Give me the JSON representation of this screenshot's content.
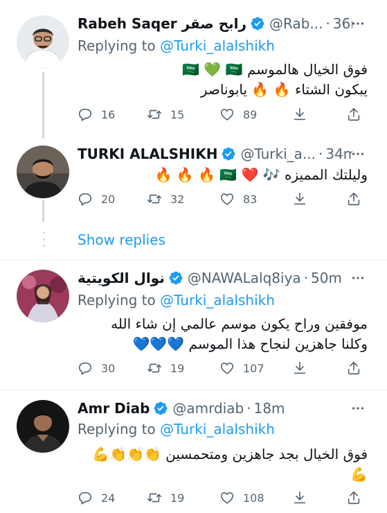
{
  "tweets": [
    {
      "name": "Rabeh Saqer رابح صقر",
      "handle": "@Rab...",
      "time": "36m",
      "reply_prefix": "Replying to",
      "reply_handle": "@Turki_alalshikh",
      "lines": [
        "فوق الخيال هالموسم 🇸🇦 💚 🇸🇦",
        "يبكون الشتاء 🔥 🔥 يابوناصر"
      ],
      "counts": {
        "replies": "16",
        "retweets": "15",
        "likes": "89"
      }
    },
    {
      "name": "TURKI ALALSHIKH",
      "handle": "@Turki_a...",
      "time": "34m",
      "lines": [
        "وليلتك المميزه 🎶 ❤️ 🇸🇦 🔥 🔥 🔥"
      ],
      "counts": {
        "replies": "20",
        "retweets": "32",
        "likes": "83"
      }
    },
    {
      "name": "نوال الكويتية",
      "handle": "@NAWALalq8iya",
      "time": "50m",
      "reply_prefix": "Replying to",
      "reply_handle": "@Turki_alalshikh",
      "lines": [
        "موفقين وراح يكون موسم عالمي إن شاء الله",
        "وكلنا جاهزين لنجاح هذا الموسم 💙💙💙"
      ],
      "counts": {
        "replies": "30",
        "retweets": "19",
        "likes": "107"
      }
    },
    {
      "name": "Amr Diab",
      "handle": "@amrdiab",
      "time": "18m",
      "reply_prefix": "Replying to",
      "reply_handle": "@Turki_alalshikh",
      "lines": [
        "فوق الخيال بجد جاهزين ومتحمسين 👏👏👏💪",
        "💪"
      ],
      "counts": {
        "replies": "24",
        "retweets": "19",
        "likes": "108"
      }
    }
  ],
  "show_replies": "Show replies",
  "separator": "·",
  "icons": {
    "verified": "verified-badge-icon",
    "more": "more-icon",
    "reply": "reply-icon",
    "retweet": "retweet-icon",
    "like": "like-icon",
    "download": "download-icon",
    "share": "share-icon"
  },
  "colors": {
    "accent": "#1d9bf0",
    "secondary_text": "#536471",
    "divider": "#eff3f4",
    "thread_line": "#cfd9de"
  }
}
